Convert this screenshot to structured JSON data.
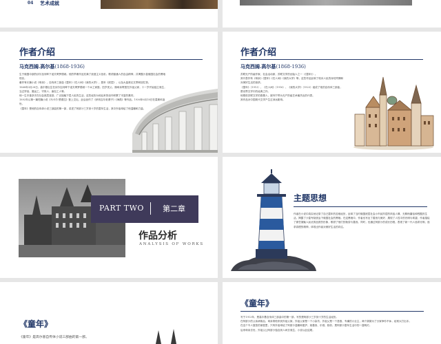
{
  "slide_top_left": {
    "num": "04",
    "label": "艺术成就"
  },
  "author_left": {
    "title": "作者介绍",
    "name": "马克西姆.高尔基",
    "years": "(1868-1936)",
    "paragraphs": [
      "生于俄国中部的伏尔加河畔下诺夫哥罗德城。他的早期作品充满了浪漫主义色彩，歌颂普通人的自由精神，并揭露沙皇俄国社会的黑暗现实。",
      "著作有长篇小说《母亲》，自传体三部曲《童年》《在人间》《我的大学》，剧本《底层》，以及大量政论文章和回忆录。",
      "1868年3月28日，高尔基出生在伏尔加河畔下诺夫哥罗德城一个木工家庭。四岁丧父，随母亲寄居在外祖父家，十一岁开始独立谋生，当过学徒、搬运工、守夜人、面包工人等。",
      "他一生中曾多次在社会底层漫游，广泛接触下层人民的生活，这些经历为他后来的创作积累了丰富的素材。",
      "1892年以第一篇短篇小说《马卡尔·楚德拉》登上文坛，此后创作了《伊则吉尔老婆子》《海燕》等作品。1936年6月18日在莫斯科逝世。",
      "《童年》是他的自传体小说三部曲的第一部，讲述了阿廖沙三岁到十岁的童年生活，其中外祖母给了他温暖和力量。"
    ]
  },
  "author_right": {
    "title": "作者介绍",
    "name": "马克西姆.高尔基",
    "years": "(1868-1936)",
    "paragraphs": [
      "苏联无产阶级作家、社会活动家，苏联文学的创始人之一（《童年》）。",
      "其代表作有《母亲》《童年》《在人间》《我的大学》等，这些作品反映了他对人民的深切同情和对美好生活的追求。",
      "《童年》（1913）、《在人间》（1916）、《我的大学》（1923）组成了他的自传体三部曲，是世界文学中的经典之作。",
      "他是前苏联文学的奠基人，被列宁誉为无产阶级艺术最杰出的代表。",
      "其作品对中国现代文学产生过深远影响。"
    ]
  },
  "part_two": {
    "part_label": "PART TWO",
    "chapter": "第二章",
    "title": "作品分析",
    "subtitle": "ANALYSIS OF WORKS"
  },
  "theme": {
    "title": "主题思想",
    "text": "作者在小说中真实地记录了自己童年的苦难经历，反映了当时俄国底层社会小市民阶层的风俗人情、无聊而庸俗和残酷的生活，揭露了沙皇专制统治下俄国社会的黑暗。在这黑暗中，作者也写出了善良与美好，展现了人性中的光明与希望。作者描绘了那些凝聚人民优秀品质的形象，歌颂了他们的勤劳与善良。同时，也通过阿廖沙的成长历程，表现了新一代人追求光明、追求真理的精神，体现出作者对美好生活的向往。"
  },
  "childhood_left": {
    "title": "《童年》",
    "text": "《童年》是高尔基自传体小说三部曲的第一部。"
  },
  "childhood_right": {
    "title": "《童年》",
    "paragraphs": [
      "写于1913年，是高尔基自传体三部曲中的第一部，写的是阿廖沙三岁到十岁的生活经历。",
      "在阿廖沙的父亲病故后，母亲带他来到外祖父家。外祖父家是一个小染坊，外祖父是一个吝啬、专横的小业主，两个舅舅为了分家争吵不休，经常大打出手。",
      "在这个令人窒息的家庭里，只有外祖母给了阿廖沙温暖和爱护，她善良、乐观、勤劳，是阿廖沙童年生活中的一盏明灯。",
      "后来母亲去世，外祖父让阿廖沙独自到人间去谋生，小说以此结尾。"
    ]
  }
}
